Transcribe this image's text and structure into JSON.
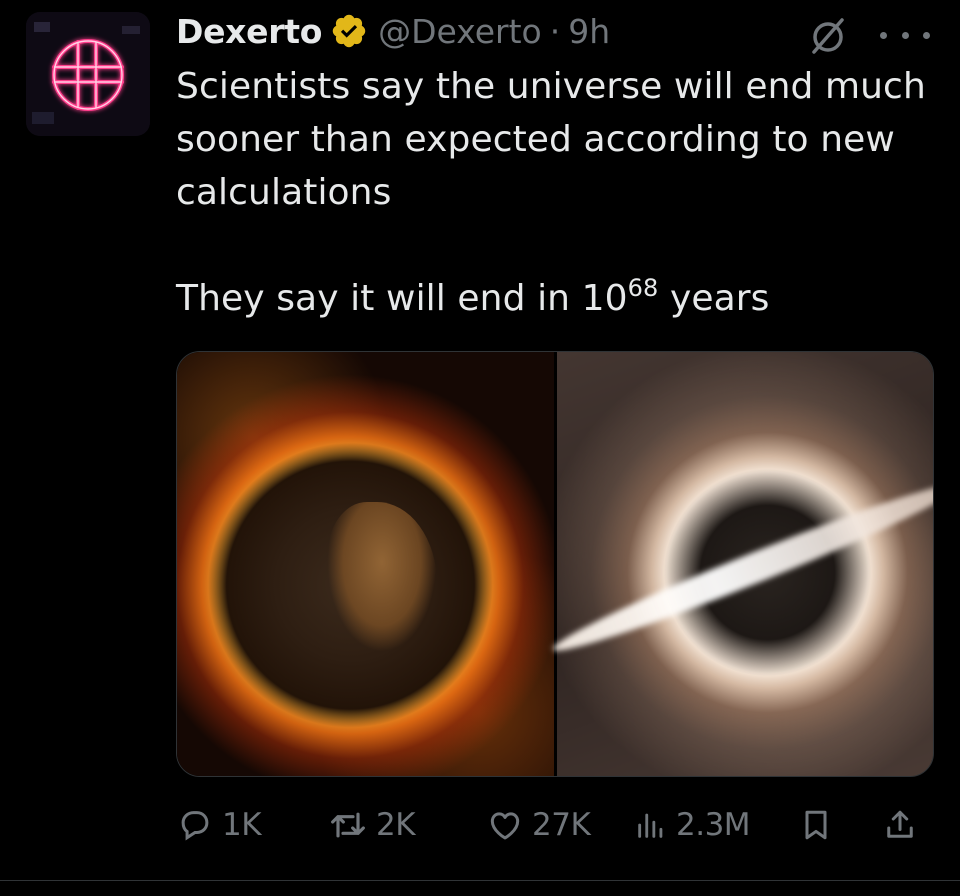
{
  "tweet": {
    "author": {
      "name": "Dexerto",
      "handle": "@Dexerto",
      "time": "9h",
      "separator": "·",
      "verified": true,
      "verified_color": "#e2b719"
    },
    "text": {
      "line1": "Scientists say the universe will end much sooner than expected according to new calculations",
      "line2_prefix": "They say it will end in 10",
      "line2_exponent": "68",
      "line2_suffix": " years"
    },
    "media": [
      {
        "icon": "burning-earth-image"
      },
      {
        "icon": "black-hole-image"
      }
    ],
    "actions": {
      "replies": "1K",
      "reposts": "2K",
      "likes": "27K",
      "views": "2.3M"
    },
    "icons": {
      "grok": "grok-icon",
      "more": "more-icon",
      "reply": "reply-icon",
      "repost": "repost-icon",
      "like": "heart-icon",
      "views": "views-icon",
      "bookmark": "bookmark-icon",
      "share": "share-icon"
    },
    "colors": {
      "background": "#000000",
      "text": "#e7e9ea",
      "muted": "#71767b",
      "avatar_neon": "#ff3d8b"
    }
  }
}
